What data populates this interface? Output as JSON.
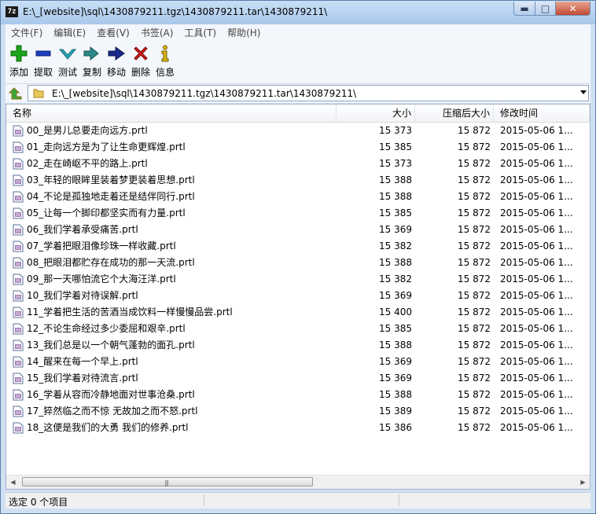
{
  "window": {
    "app_icon": "7z",
    "title": "E:\\_[website]\\sql\\1430879211.tgz\\1430879211.tar\\1430879211\\",
    "minimize": "▬",
    "maximize": "□",
    "close": "✕"
  },
  "menu": [
    "文件(F)",
    "编辑(E)",
    "查看(V)",
    "书签(A)",
    "工具(T)",
    "帮助(H)"
  ],
  "toolbar": [
    {
      "label": "添加",
      "icon": "plus-icon",
      "color": "#1aa51a"
    },
    {
      "label": "提取",
      "icon": "minus-icon",
      "color": "#1c3fbf"
    },
    {
      "label": "测试",
      "icon": "check-icon",
      "color": "#2aa7b8"
    },
    {
      "label": "复制",
      "icon": "copy-arrow-icon",
      "color": "#2a8a8a"
    },
    {
      "label": "移动",
      "icon": "move-arrow-icon",
      "color": "#1a2a8a"
    },
    {
      "label": "删除",
      "icon": "delete-x-icon",
      "color": "#d21a1a"
    },
    {
      "label": "信息",
      "icon": "info-icon",
      "color": "#c9a400"
    }
  ],
  "address": {
    "path": "E:\\_[website]\\sql\\1430879211.tgz\\1430879211.tar\\1430879211\\"
  },
  "columns": {
    "name": "名称",
    "size": "大小",
    "packed": "压缩后大小",
    "modified": "修改时间"
  },
  "files": [
    {
      "name": "00_是男儿总要走向远方.prtl",
      "size": "15 373",
      "packed": "15 872",
      "modified": "2015-05-06 1..."
    },
    {
      "name": "01_走向远方是为了让生命更辉煌.prtl",
      "size": "15 385",
      "packed": "15 872",
      "modified": "2015-05-06 1..."
    },
    {
      "name": "02_走在崎岖不平的路上.prtl",
      "size": "15 373",
      "packed": "15 872",
      "modified": "2015-05-06 1..."
    },
    {
      "name": "03_年轻的眼眸里装着梦更装着思想.prtl",
      "size": "15 388",
      "packed": "15 872",
      "modified": "2015-05-06 1..."
    },
    {
      "name": "04_不论是孤独地走着还是结伴同行.prtl",
      "size": "15 388",
      "packed": "15 872",
      "modified": "2015-05-06 1..."
    },
    {
      "name": "05_让每一个脚印都坚实而有力量.prtl",
      "size": "15 385",
      "packed": "15 872",
      "modified": "2015-05-06 1..."
    },
    {
      "name": "06_我们学着承受痛苦.prtl",
      "size": "15 369",
      "packed": "15 872",
      "modified": "2015-05-06 1..."
    },
    {
      "name": "07_学着把眼泪像珍珠一样收藏.prtl",
      "size": "15 382",
      "packed": "15 872",
      "modified": "2015-05-06 1..."
    },
    {
      "name": "08_把眼泪都贮存在成功的那一天流.prtl",
      "size": "15 388",
      "packed": "15 872",
      "modified": "2015-05-06 1..."
    },
    {
      "name": "09_那一天哪怕流它个大海汪洋.prtl",
      "size": "15 382",
      "packed": "15 872",
      "modified": "2015-05-06 1..."
    },
    {
      "name": "10_我们学着对待误解.prtl",
      "size": "15 369",
      "packed": "15 872",
      "modified": "2015-05-06 1..."
    },
    {
      "name": "11_学着把生活的苦酒当成饮料一样慢慢品尝.prtl",
      "size": "15 400",
      "packed": "15 872",
      "modified": "2015-05-06 1..."
    },
    {
      "name": "12_不论生命经过多少委屈和艰辛.prtl",
      "size": "15 385",
      "packed": "15 872",
      "modified": "2015-05-06 1..."
    },
    {
      "name": "13_我们总是以一个朝气蓬勃的面孔.prtl",
      "size": "15 388",
      "packed": "15 872",
      "modified": "2015-05-06 1..."
    },
    {
      "name": "14_醒来在每一个早上.prtl",
      "size": "15 369",
      "packed": "15 872",
      "modified": "2015-05-06 1..."
    },
    {
      "name": "15_我们学着对待流言.prtl",
      "size": "15 369",
      "packed": "15 872",
      "modified": "2015-05-06 1..."
    },
    {
      "name": "16_学着从容而冷静地面对世事沧桑.prtl",
      "size": "15 388",
      "packed": "15 872",
      "modified": "2015-05-06 1..."
    },
    {
      "name": "17_猝然临之而不惊 无故加之而不怒.prtl",
      "size": "15 389",
      "packed": "15 872",
      "modified": "2015-05-06 1..."
    },
    {
      "name": "18_这便是我们的大勇 我们的修养.prtl",
      "size": "15 386",
      "packed": "15 872",
      "modified": "2015-05-06 1..."
    }
  ],
  "scrollbar": {
    "left_arrow": "◀",
    "right_arrow": "▶",
    "grip": "|||"
  },
  "status": {
    "text": "选定 0 个项目"
  }
}
